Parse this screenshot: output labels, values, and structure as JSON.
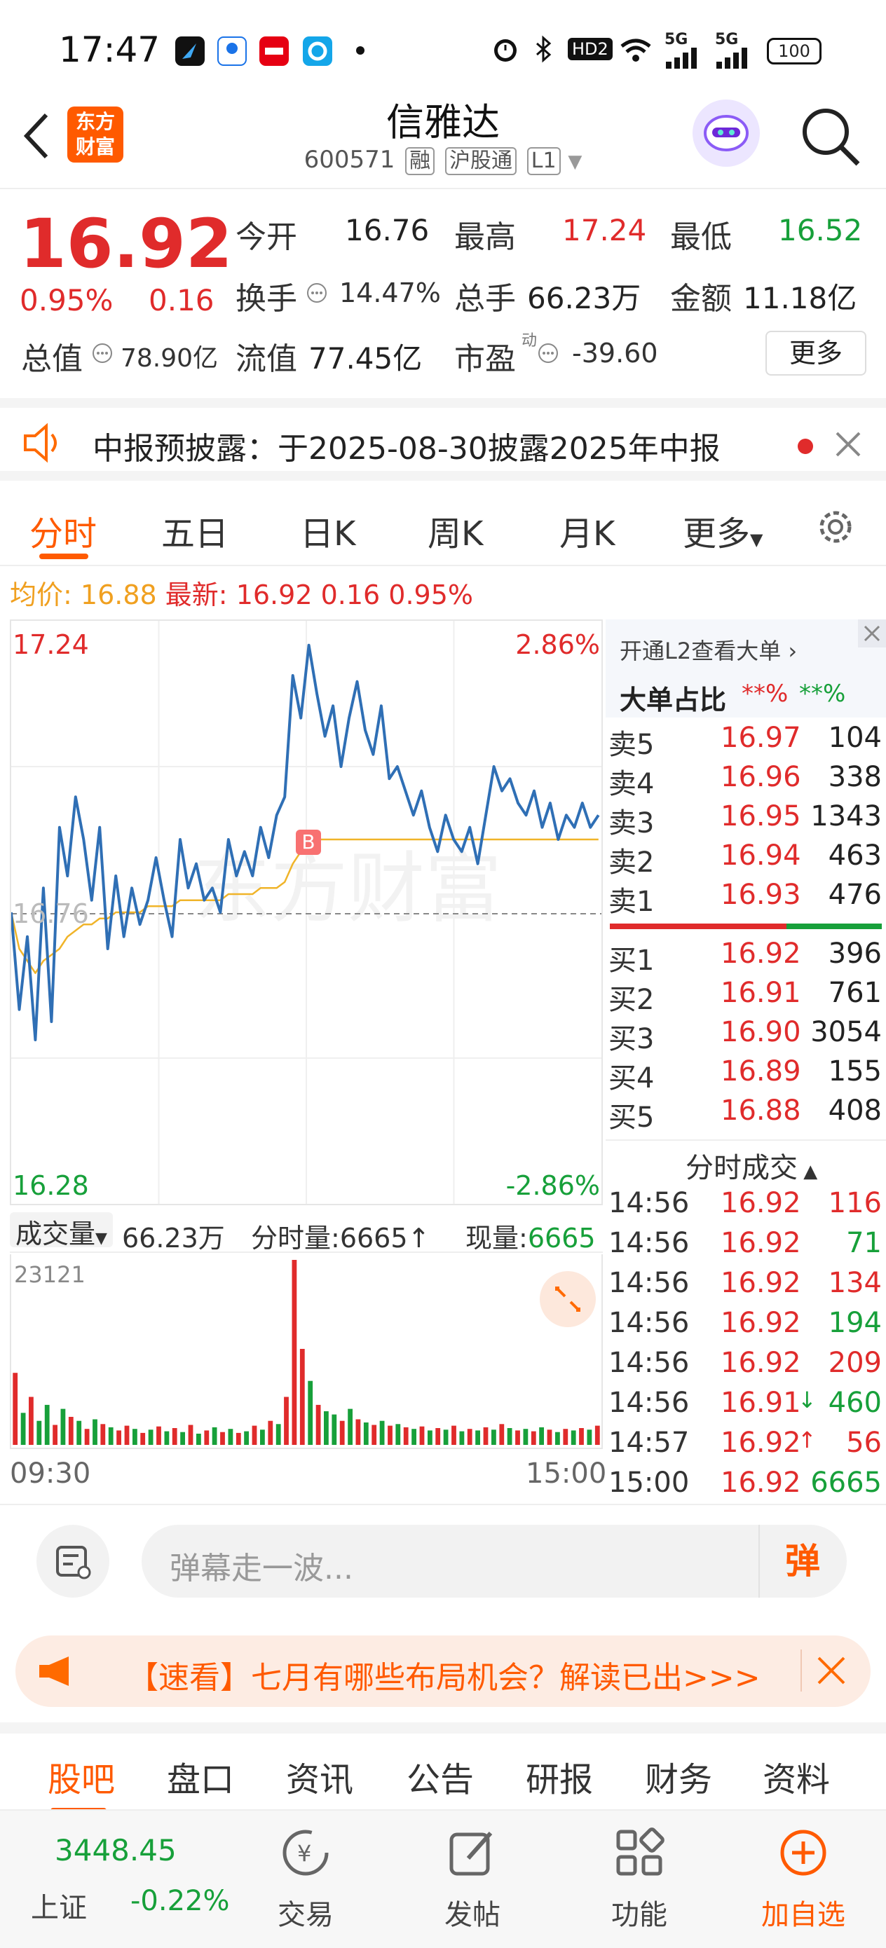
{
  "status_bar": {
    "time": "17:47",
    "battery": "100",
    "network_1": "5G",
    "network_2": "5G",
    "hd_label": "HD2"
  },
  "header": {
    "back_icon": "chevron-left",
    "brand_logo": "东方财富",
    "title": "信雅达",
    "code": "600571",
    "tags": [
      "融",
      "沪股通",
      "L1"
    ]
  },
  "quote": {
    "price": "16.92",
    "change_pct": "0.95%",
    "change": "0.16",
    "open_label": "今开",
    "open": "16.76",
    "high_label": "最高",
    "high": "17.24",
    "low_label": "最低",
    "low": "16.52",
    "turnover_label": "换手",
    "turnover": "14.47%",
    "volume_label": "总手",
    "volume": "66.23万",
    "amount_label": "金额",
    "amount": "11.18亿",
    "mcap_label": "总值",
    "mcap": "78.90亿",
    "float_label": "流值",
    "float_val": "77.45亿",
    "pe_label": "市盈",
    "pe_sup": "动",
    "pe": "-39.60",
    "more_label": "更多"
  },
  "notice": {
    "text": "中报预披露：于2025-08-30披露2025年中报"
  },
  "chart_tabs": [
    "分时",
    "五日",
    "日K",
    "周K",
    "月K",
    "更多"
  ],
  "avg_line": {
    "avg_label": "均价:",
    "avg": "16.88",
    "latest_label": "最新:",
    "latest": "16.92",
    "change": "0.16",
    "change_pct": "0.95%"
  },
  "chart_labels": {
    "top_price": "17.24",
    "top_pct": "2.86%",
    "mid_price": "16.76",
    "bottom_price": "16.28",
    "bottom_pct": "-2.86%",
    "buy_marker": "B"
  },
  "volume_bar": {
    "label": "成交量",
    "total": "66.23万",
    "minute_label": "分时量:",
    "minute": "6665",
    "current_label": "现量:",
    "current": "6665",
    "max_label": "23121",
    "start_time": "09:30",
    "end_time": "15:00"
  },
  "order_book": {
    "l2_link": "开通L2查看大单",
    "big_order_label": "大单占比",
    "big_red": "**%",
    "big_green": "**%",
    "asks": [
      {
        "label": "卖5",
        "price": "16.97",
        "vol": "104"
      },
      {
        "label": "卖4",
        "price": "16.96",
        "vol": "338"
      },
      {
        "label": "卖3",
        "price": "16.95",
        "vol": "1343"
      },
      {
        "label": "卖2",
        "price": "16.94",
        "vol": "463"
      },
      {
        "label": "卖1",
        "price": "16.93",
        "vol": "476"
      }
    ],
    "bids": [
      {
        "label": "买1",
        "price": "16.92",
        "vol": "396"
      },
      {
        "label": "买2",
        "price": "16.91",
        "vol": "761"
      },
      {
        "label": "买3",
        "price": "16.90",
        "vol": "3054"
      },
      {
        "label": "买4",
        "price": "16.89",
        "vol": "155"
      },
      {
        "label": "买5",
        "price": "16.88",
        "vol": "408"
      }
    ],
    "ticks_title": "分时成交",
    "ticks": [
      {
        "time": "14:56",
        "price": "16.92",
        "vol": "116",
        "dir": "",
        "vol_color": "red"
      },
      {
        "time": "14:56",
        "price": "16.92",
        "vol": "71",
        "dir": "",
        "vol_color": "green"
      },
      {
        "time": "14:56",
        "price": "16.92",
        "vol": "134",
        "dir": "",
        "vol_color": "red"
      },
      {
        "time": "14:56",
        "price": "16.92",
        "vol": "194",
        "dir": "",
        "vol_color": "green"
      },
      {
        "time": "14:56",
        "price": "16.92",
        "vol": "209",
        "dir": "",
        "vol_color": "red"
      },
      {
        "time": "14:56",
        "price": "16.91",
        "vol": "460",
        "dir": "↓",
        "vol_color": "green"
      },
      {
        "time": "14:57",
        "price": "16.92",
        "vol": "56",
        "dir": "↑",
        "vol_color": "red"
      },
      {
        "time": "15:00",
        "price": "16.92",
        "vol": "6665",
        "dir": "",
        "vol_color": "green"
      }
    ]
  },
  "comment_bar": {
    "placeholder": "弹幕走一波...",
    "danmu_label": "弹"
  },
  "banner": {
    "text": "【速看】七月有哪些布局机会？解读已出>>>"
  },
  "bottom_tabs": [
    "股吧",
    "盘口",
    "资讯",
    "公告",
    "研报",
    "财务",
    "资料"
  ],
  "bottom_nav": {
    "index_value": "3448.45",
    "index_name": "上证",
    "index_change": "-0.22%",
    "items": [
      "交易",
      "发帖",
      "功能",
      "加自选"
    ]
  },
  "colors": {
    "up": "#e02b2b",
    "down": "#17a03a",
    "accent": "#ff5a00",
    "price_line": "#2f6fb5",
    "avg_line": "#f0b429"
  },
  "chart_data": {
    "type": "line",
    "title": "",
    "xlabel": "",
    "ylabel": "",
    "x_range": [
      "09:30",
      "15:00"
    ],
    "ylim": [
      16.28,
      17.24
    ],
    "prev_close": 16.76,
    "series": [
      {
        "name": "",
        "values": [
          16.76,
          16.6,
          16.72,
          16.55,
          16.8,
          16.58,
          16.9,
          16.82,
          16.95,
          16.88,
          16.78,
          16.9,
          16.7,
          16.82,
          16.72,
          16.8,
          16.74,
          16.78,
          16.85,
          16.78,
          16.72,
          16.88,
          16.8,
          16.84,
          16.78,
          16.8,
          16.76,
          16.88,
          16.82,
          16.86,
          16.82,
          16.9,
          16.85,
          16.92,
          16.95,
          17.15,
          17.08,
          17.2,
          17.12,
          17.05,
          17.1,
          17.0,
          17.08,
          17.14,
          17.06,
          17.02,
          17.1,
          16.98,
          17.0,
          16.96,
          16.92,
          16.96,
          16.9,
          16.86,
          16.92,
          16.88,
          16.86,
          16.9,
          16.84,
          16.92,
          17.0,
          16.96,
          16.98,
          16.94,
          16.92,
          16.96,
          16.9,
          16.94,
          16.88,
          16.92,
          16.9,
          16.94,
          16.9,
          16.92
        ]
      },
      {
        "name": "均价",
        "values": [
          16.76,
          16.7,
          16.68,
          16.66,
          16.68,
          16.69,
          16.7,
          16.72,
          16.73,
          16.74,
          16.74,
          16.75,
          16.75,
          16.76,
          16.76,
          16.76,
          16.76,
          16.77,
          16.77,
          16.77,
          16.77,
          16.78,
          16.78,
          16.78,
          16.78,
          16.78,
          16.78,
          16.79,
          16.79,
          16.79,
          16.79,
          16.8,
          16.8,
          16.8,
          16.81,
          16.84,
          16.86,
          16.87,
          16.88,
          16.88,
          16.88,
          16.88,
          16.88,
          16.88,
          16.88,
          16.88,
          16.88,
          16.88,
          16.88,
          16.88,
          16.88,
          16.88,
          16.88,
          16.88,
          16.88,
          16.88,
          16.88,
          16.88,
          16.88,
          16.88,
          16.88,
          16.88,
          16.88,
          16.88,
          16.88,
          16.88,
          16.88,
          16.88,
          16.88,
          16.88,
          16.88,
          16.88,
          16.88,
          16.88
        ]
      }
    ],
    "volume": {
      "max": 23121,
      "values": [
        9000,
        4000,
        6000,
        3000,
        5000,
        2500,
        4500,
        3500,
        3000,
        2000,
        3200,
        2600,
        2200,
        1800,
        2400,
        2000,
        1500,
        1900,
        2300,
        1700,
        2100,
        1600,
        2500,
        1400,
        1800,
        2200,
        1600,
        2000,
        1500,
        1700,
        2400,
        1900,
        3000,
        2600,
        6000,
        23121,
        12000,
        8000,
        5000,
        4200,
        3800,
        3000,
        4500,
        3200,
        2800,
        2500,
        3000,
        2400,
        2600,
        2200,
        2000,
        2300,
        1800,
        2100,
        1900,
        2400,
        1700,
        2000,
        1800,
        2200,
        1900,
        2600,
        2100,
        1800,
        2000,
        1700,
        2200,
        1900,
        1600,
        2000,
        1800,
        2100,
        1900,
        2400
      ],
      "colors": [
        "red",
        "green",
        "red",
        "green",
        "green",
        "red",
        "green",
        "red",
        "green",
        "red",
        "green",
        "red",
        "green",
        "red",
        "red",
        "green",
        "red",
        "green",
        "red",
        "green",
        "red",
        "green",
        "red",
        "green",
        "red",
        "green",
        "red",
        "green",
        "red",
        "green",
        "red",
        "green",
        "red",
        "green",
        "red",
        "red",
        "red",
        "green",
        "red",
        "green",
        "green",
        "red",
        "green",
        "red",
        "green",
        "red",
        "green",
        "red",
        "green",
        "red",
        "green",
        "red",
        "green",
        "red",
        "green",
        "red",
        "green",
        "red",
        "green",
        "red",
        "green",
        "red",
        "green",
        "red",
        "green",
        "red",
        "green",
        "red",
        "green",
        "red",
        "green",
        "red",
        "green",
        "red"
      ]
    }
  }
}
